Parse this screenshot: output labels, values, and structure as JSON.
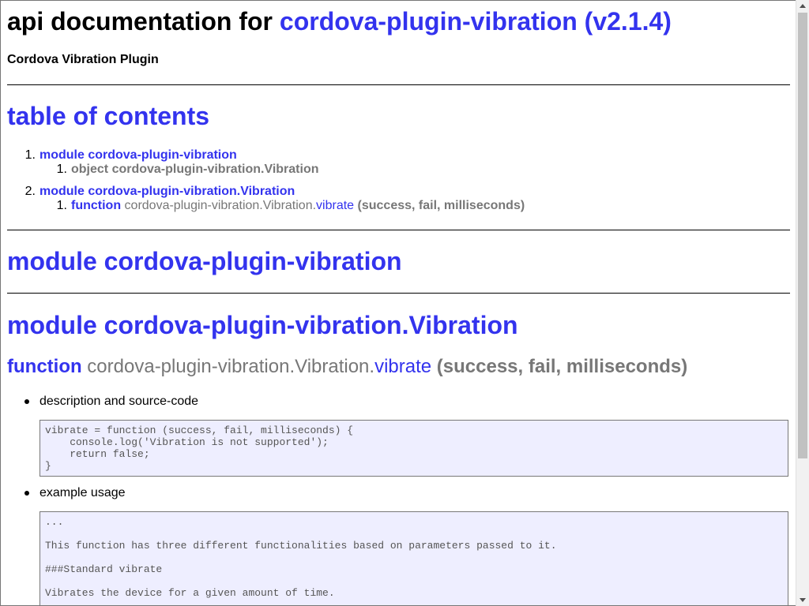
{
  "header": {
    "title_prefix": "api documentation for ",
    "title_link": "cordova-plugin-vibration (v2.1.4)",
    "subtitle": "Cordova Vibration Plugin"
  },
  "toc": {
    "heading": "table of contents",
    "items": [
      {
        "num": "1.",
        "label": "module cordova-plugin-vibration",
        "children": [
          {
            "num": "1.",
            "text": "object cordova-plugin-vibration.Vibration"
          }
        ]
      },
      {
        "num": "2.",
        "label": "module cordova-plugin-vibration.Vibration",
        "children": [
          {
            "num": "1.",
            "kind": "function",
            "path": " cordova-plugin-vibration.Vibration.",
            "name": "vibrate",
            "params": " (success, fail, milliseconds)"
          }
        ]
      }
    ]
  },
  "sections": {
    "module1": "module cordova-plugin-vibration",
    "module2": "module cordova-plugin-vibration.Vibration"
  },
  "function": {
    "kind": "function",
    "path": " cordova-plugin-vibration.Vibration.",
    "name": "vibrate",
    "params": " (success, fail, milliseconds)"
  },
  "details": [
    {
      "label": "description and source-code",
      "code": "vibrate = function (success, fail, milliseconds) {\n    console.log('Vibration is not supported');\n    return false;\n}"
    },
    {
      "label": "example usage",
      "code": "...\n\nThis function has three different functionalities based on parameters passed to it.\n\n###Standard vibrate\n\nVibrates the device for a given amount of time."
    }
  ]
}
